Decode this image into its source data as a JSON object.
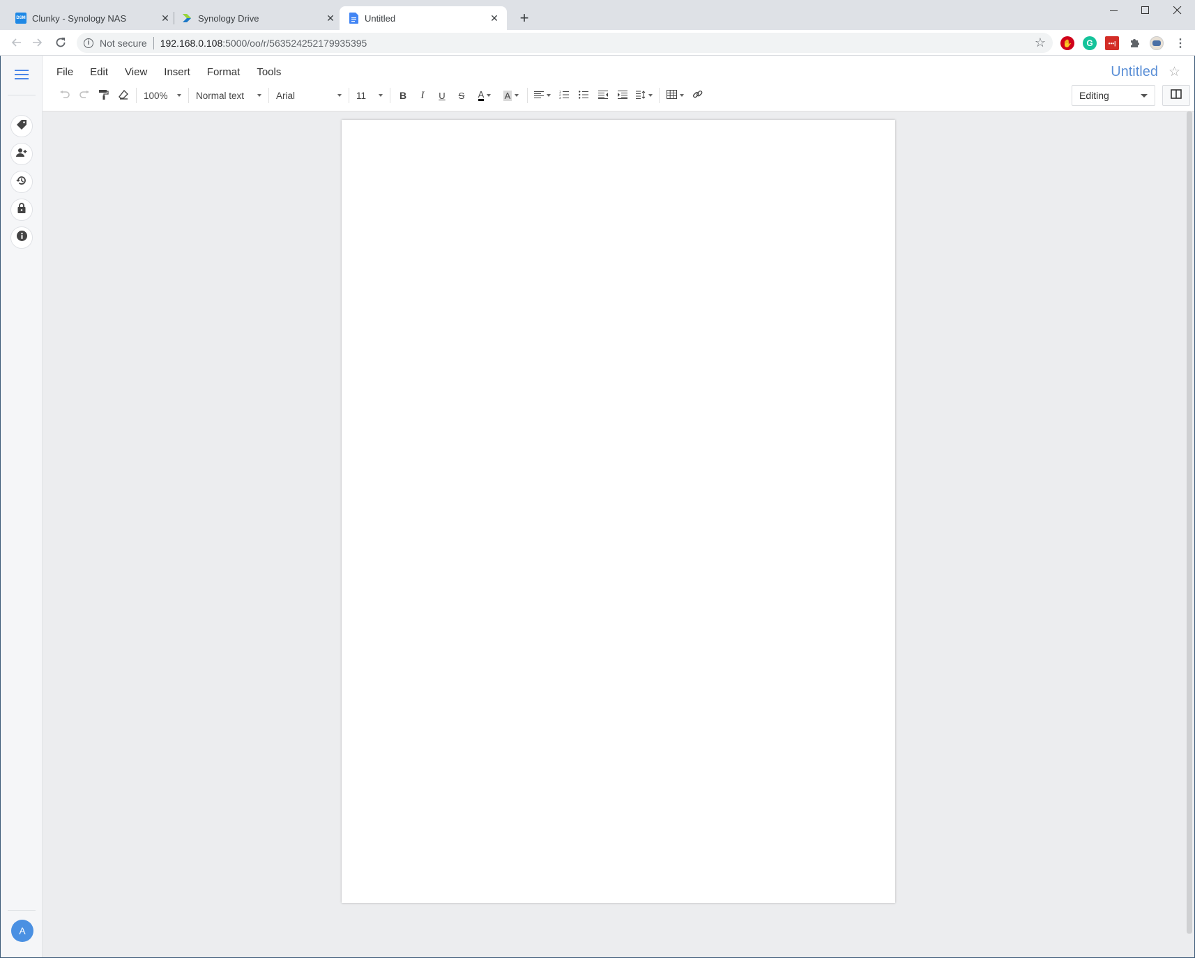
{
  "browser": {
    "tabs": [
      {
        "title": "Clunky - Synology NAS",
        "icon": "dsm-icon",
        "active": false
      },
      {
        "title": "Synology Drive",
        "icon": "synology-drive-icon",
        "active": false
      },
      {
        "title": "Untitled",
        "icon": "docs-icon",
        "active": true
      }
    ],
    "new_tab": "+",
    "window_controls": {
      "minimize": "—",
      "maximize": "☐",
      "close": "✕"
    },
    "security_label": "Not secure",
    "url_host": "192.168.0.108",
    "url_path": ":5000/oo/r/563524252179935395",
    "extensions": [
      "adblock-icon",
      "grammarly-icon",
      "lastpass-icon",
      "extensions-puzzle-icon",
      "profile-avatar-icon"
    ]
  },
  "sidebar": {
    "menu_icon": "hamburger-icon",
    "items": [
      {
        "name": "labels",
        "icon": "tag-icon"
      },
      {
        "name": "share",
        "icon": "add-user-icon"
      },
      {
        "name": "version-history",
        "icon": "history-icon"
      },
      {
        "name": "lock",
        "icon": "lock-icon"
      },
      {
        "name": "info",
        "icon": "info-icon"
      }
    ],
    "avatar_letter": "A"
  },
  "menu": [
    "File",
    "Edit",
    "View",
    "Insert",
    "Format",
    "Tools"
  ],
  "document": {
    "title": "Untitled",
    "mode": "Editing"
  },
  "toolbar": {
    "zoom": "100%",
    "style": "Normal text",
    "font": "Arial",
    "size": "11",
    "bold": "B",
    "italic": "I",
    "underline": "U",
    "strike": "S",
    "text_color_letter": "A",
    "highlight_letter": "A",
    "text_color": "#000000",
    "highlight_color": "#d9d9d9"
  },
  "colors": {
    "accent": "#4a86e8",
    "title": "#5b8fd6",
    "avatar": "#4a90e2"
  }
}
